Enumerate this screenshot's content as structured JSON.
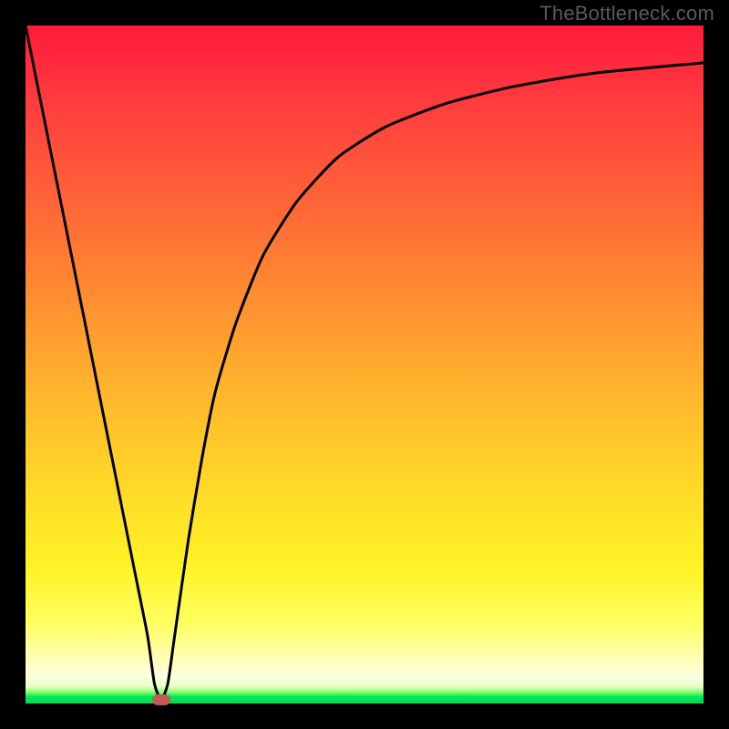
{
  "watermark": "TheBottleneck.com",
  "chart_data": {
    "type": "line",
    "title": "",
    "xlabel": "",
    "ylabel": "",
    "xlim": [
      0,
      100
    ],
    "ylim": [
      0,
      100
    ],
    "series": [
      {
        "name": "curve",
        "x": [
          0,
          8,
          12,
          16,
          18,
          19,
          20,
          21,
          22,
          24,
          26,
          28,
          31,
          35,
          40,
          46,
          53,
          62,
          72,
          84,
          100
        ],
        "values": [
          100,
          60,
          40,
          20,
          10,
          3,
          0.5,
          3,
          10,
          24,
          36,
          46,
          56,
          66,
          74,
          80.5,
          85,
          88.5,
          91,
          93,
          94.5
        ]
      }
    ],
    "marker": {
      "x": 20,
      "y": 0.5,
      "color": "#c25a52"
    },
    "gradient_colors": {
      "top": "#ff1a3c",
      "mid_orange": "#ff9330",
      "yellow": "#ffd928",
      "pale": "#ffffb8",
      "green": "#00d850"
    }
  }
}
